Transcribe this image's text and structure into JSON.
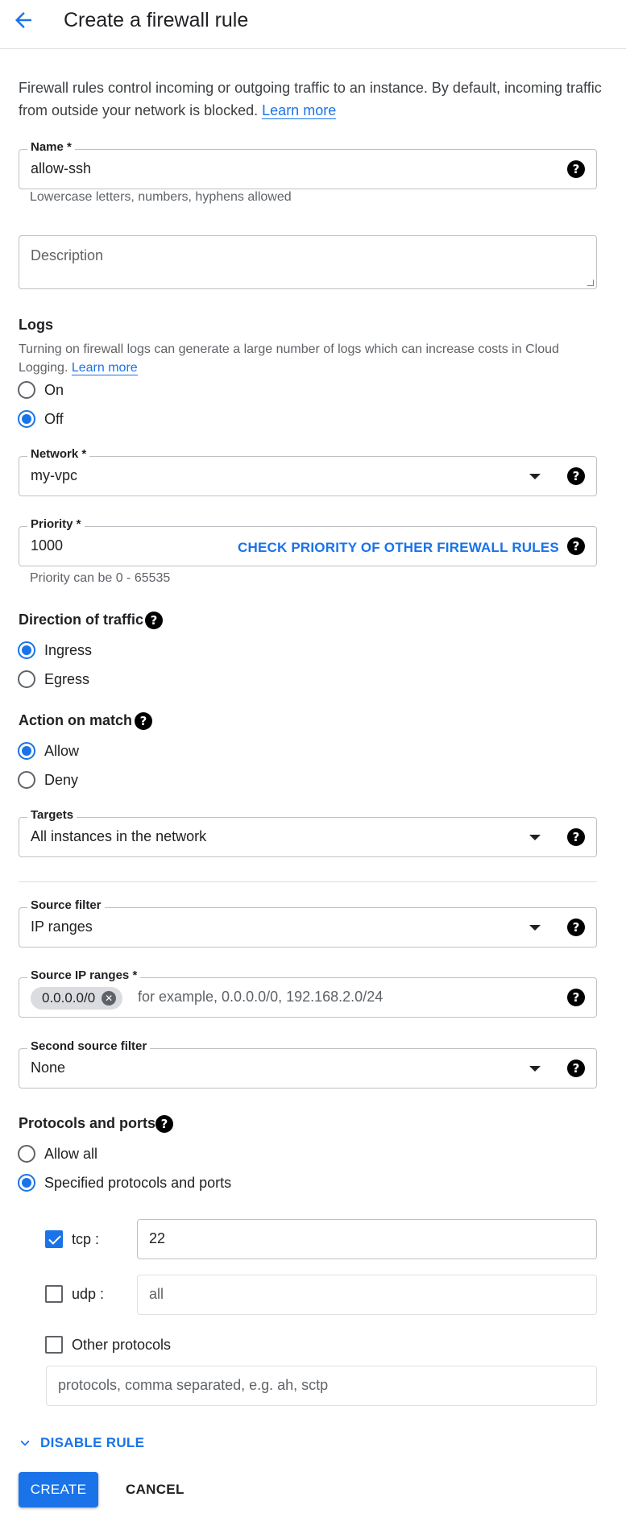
{
  "header": {
    "title": "Create a firewall rule"
  },
  "intro": {
    "text": "Firewall rules control incoming or outgoing traffic to an instance. By default, incoming traffic from outside your network is blocked.",
    "learn_more": "Learn more"
  },
  "name_field": {
    "label": "Name *",
    "value": "allow-ssh",
    "helper": "Lowercase letters, numbers, hyphens allowed"
  },
  "description_field": {
    "placeholder": "Description"
  },
  "logs": {
    "title": "Logs",
    "text": "Turning on firewall logs can generate a large number of logs which can increase costs in Cloud Logging.",
    "learn_more": "Learn more",
    "options": [
      {
        "label": "On",
        "selected": false
      },
      {
        "label": "Off",
        "selected": true
      }
    ]
  },
  "network_field": {
    "label": "Network *",
    "value": "my-vpc"
  },
  "priority_field": {
    "label": "Priority *",
    "value": "1000",
    "link": "CHECK PRIORITY OF OTHER FIREWALL RULES",
    "helper": "Priority can be 0 - 65535"
  },
  "direction": {
    "title": "Direction of traffic",
    "options": [
      {
        "label": "Ingress",
        "selected": true
      },
      {
        "label": "Egress",
        "selected": false
      }
    ]
  },
  "action": {
    "title": "Action on match",
    "options": [
      {
        "label": "Allow",
        "selected": true
      },
      {
        "label": "Deny",
        "selected": false
      }
    ]
  },
  "targets_field": {
    "label": "Targets",
    "value": "All instances in the network"
  },
  "source_filter_field": {
    "label": "Source filter",
    "value": "IP ranges"
  },
  "source_ip_field": {
    "label": "Source IP ranges *",
    "chip": "0.0.0.0/0",
    "placeholder": "for example, 0.0.0.0/0, 192.168.2.0/24"
  },
  "second_source_field": {
    "label": "Second source filter",
    "value": "None"
  },
  "protocols": {
    "title": "Protocols and ports",
    "options": [
      {
        "label": "Allow all",
        "selected": false
      },
      {
        "label": "Specified protocols and ports",
        "selected": true
      }
    ],
    "tcp": {
      "label": "tcp :",
      "checked": true,
      "value": "22"
    },
    "udp": {
      "label": "udp :",
      "checked": false,
      "placeholder": "all"
    },
    "other": {
      "label": "Other protocols",
      "checked": false,
      "placeholder": "protocols, comma separated, e.g. ah, sctp"
    }
  },
  "disable_rule": {
    "label": "DISABLE RULE"
  },
  "actions": {
    "create": "CREATE",
    "cancel": "CANCEL"
  },
  "colors": {
    "accent": "#1a73e8",
    "text": "#202124",
    "secondary": "#5f6368",
    "border": "#bdc1c6"
  },
  "icons": {
    "back": "arrow-back-icon",
    "help": "help-circle-icon",
    "dropdown": "arrow-drop-down-icon",
    "clear": "clear-icon",
    "expand": "chevron-down-icon"
  }
}
